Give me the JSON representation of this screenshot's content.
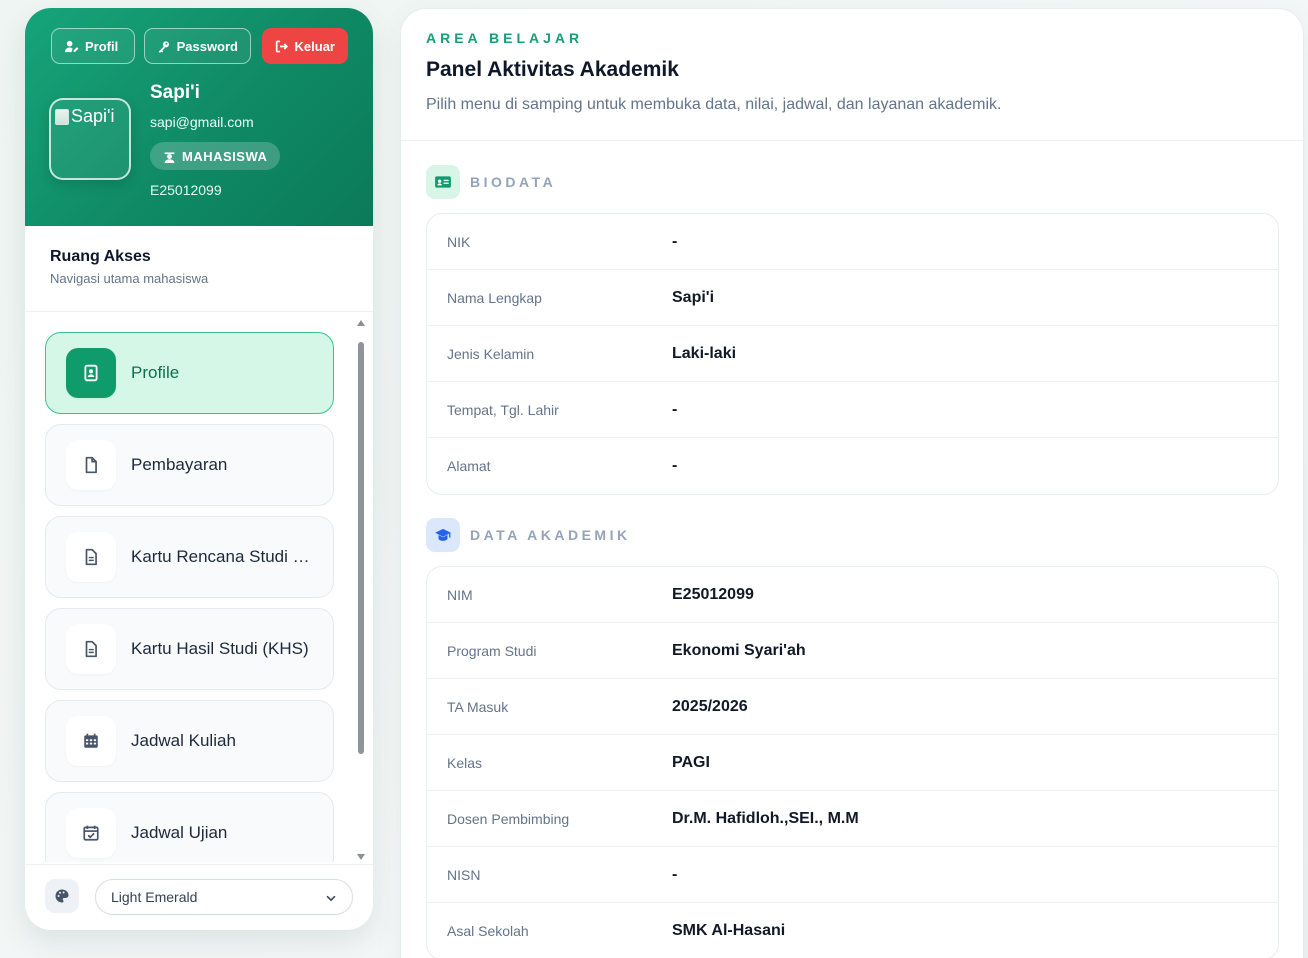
{
  "header_buttons": {
    "profil": "Profil",
    "password": "Password",
    "keluar": "Keluar"
  },
  "user": {
    "avatar_alt": "Sapi'i",
    "name": "Sapi'i",
    "email": "sapi@gmail.com",
    "role": "MAHASISWA",
    "id": "E25012099"
  },
  "sidebar": {
    "title": "Ruang Akses",
    "subtitle": "Navigasi utama mahasiswa",
    "menu": [
      {
        "label": "Profile",
        "icon": "id-badge-icon"
      },
      {
        "label": "Pembayaran",
        "icon": "file-icon"
      },
      {
        "label": "Kartu Rencana Studi (KRS)",
        "icon": "file-lines-icon"
      },
      {
        "label": "Kartu Hasil Studi (KHS)",
        "icon": "file-lines-icon"
      },
      {
        "label": "Jadwal Kuliah",
        "icon": "calendar-grid-icon"
      },
      {
        "label": "Jadwal Ujian",
        "icon": "calendar-check-icon"
      }
    ]
  },
  "theme": {
    "selected": "Light Emerald"
  },
  "main": {
    "eyebrow": "AREA BELAJAR",
    "title": "Panel Aktivitas Akademik",
    "description": "Pilih menu di samping untuk membuka data, nilai, jadwal, dan layanan akademik."
  },
  "biodata": {
    "title": "BIODATA",
    "rows": [
      {
        "label": "NIK",
        "value": "-"
      },
      {
        "label": "Nama Lengkap",
        "value": "Sapi'i"
      },
      {
        "label": "Jenis Kelamin",
        "value": "Laki-laki"
      },
      {
        "label": "Tempat, Tgl. Lahir",
        "value": "-"
      },
      {
        "label": "Alamat",
        "value": "-"
      }
    ]
  },
  "akademik": {
    "title": "DATA AKADEMIK",
    "rows": [
      {
        "label": "NIM",
        "value": "E25012099"
      },
      {
        "label": "Program Studi",
        "value": "Ekonomi Syari'ah"
      },
      {
        "label": "TA Masuk",
        "value": "2025/2026"
      },
      {
        "label": "Kelas",
        "value": "PAGI"
      },
      {
        "label": "Dosen Pembimbing",
        "value": "Dr.M. Hafidloh.,SEI., M.M"
      },
      {
        "label": "NISN",
        "value": "-"
      },
      {
        "label": "Asal Sekolah",
        "value": "SMK Al-Hasani"
      }
    ]
  },
  "colors": {
    "brand": "#0f9b6b",
    "active_bg": "#d5f7e7",
    "logout": "#ef4444"
  }
}
